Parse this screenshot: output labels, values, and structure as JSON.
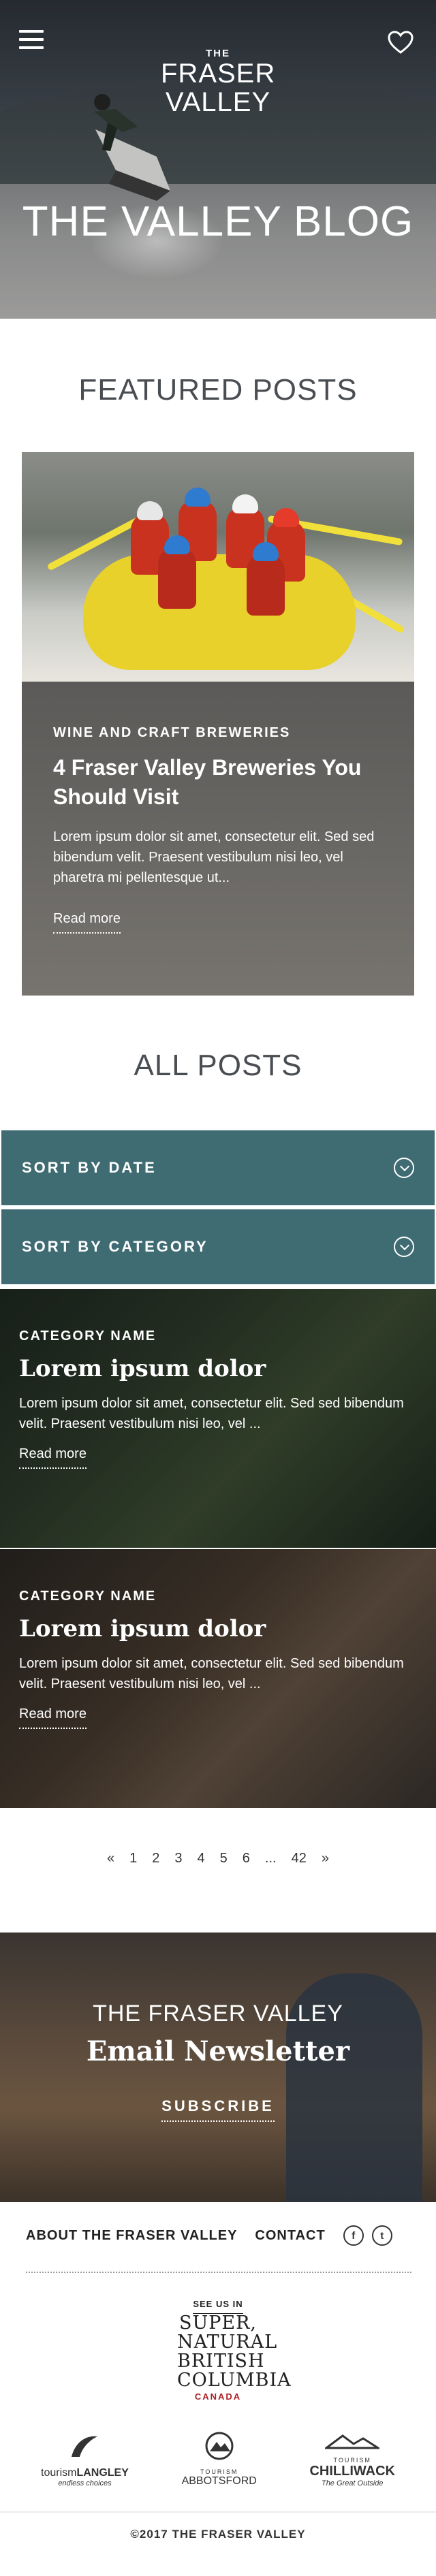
{
  "header": {
    "logo": {
      "the": "THE",
      "name_line1": "FRASER",
      "name_line2": "VALLEY"
    },
    "title": "THE VALLEY BLOG",
    "menu_icon": "hamburger-menu-icon",
    "favorites_icon": "heart-icon"
  },
  "featured": {
    "heading": "FEATURED POSTS",
    "post": {
      "category": "WINE AND CRAFT BREWERIES",
      "title": "4 Fraser Valley Breweries You Should Visit",
      "excerpt": "Lorem ipsum dolor sit amet, consectetur elit. Sed sed bibendum velit. Praesent vestibulum nisi leo, vel pharetra mi pellentesque ut...",
      "read_more": "Read more"
    }
  },
  "all_posts": {
    "heading": "ALL POSTS",
    "sort_by_date": "SORT BY DATE",
    "sort_by_category": "SORT BY CATEGORY",
    "sort_icon": "chevron-down-circle-icon",
    "posts": [
      {
        "category": "CATEGORY NAME",
        "title": "Lorem ipsum dolor",
        "excerpt": "Lorem ipsum dolor sit amet, consectetur elit. Sed sed bibendum velit. Praesent vestibulum nisi leo, vel ...",
        "read_more": "Read more"
      },
      {
        "category": "CATEGORY NAME",
        "title": "Lorem ipsum dolor",
        "excerpt": "Lorem ipsum dolor sit amet, consectetur elit. Sed sed bibendum velit. Praesent vestibulum nisi leo, vel ...",
        "read_more": "Read more"
      }
    ]
  },
  "pagination": {
    "prev": "«",
    "pages": [
      "1",
      "2",
      "3",
      "4",
      "5",
      "6",
      "...",
      "42"
    ],
    "next": "»"
  },
  "newsletter": {
    "subtitle": "THE FRASER VALLEY",
    "title": "Email Newsletter",
    "subscribe": "SUBSCRIBE"
  },
  "footer": {
    "about": "ABOUT THE FRASER VALLEY",
    "contact": "CONTACT",
    "facebook_icon": "f",
    "twitter_icon": "t",
    "sbc": {
      "see_us_in": "SEE US IN",
      "line1": "SUPER,",
      "line2": "NATURAL",
      "line3": "BRITISH",
      "line4": "COLUMBIA",
      "canada": "CANADA"
    },
    "partners": [
      {
        "name_a": "tourism",
        "name_b": "LANGLEY",
        "tagline": "endless choices"
      },
      {
        "name_a": "TOURISM",
        "name_b": "ABBOTSFORD",
        "tagline": ""
      },
      {
        "name_a": "TOURISM",
        "name_b": "CHILLIWACK",
        "tagline": "The Great Outside"
      }
    ],
    "copyright": "©2017 THE FRASER VALLEY"
  },
  "colors": {
    "accent_teal": "#3f6b72",
    "text_dark": "#333333",
    "sbc_red": "#b01f24"
  }
}
